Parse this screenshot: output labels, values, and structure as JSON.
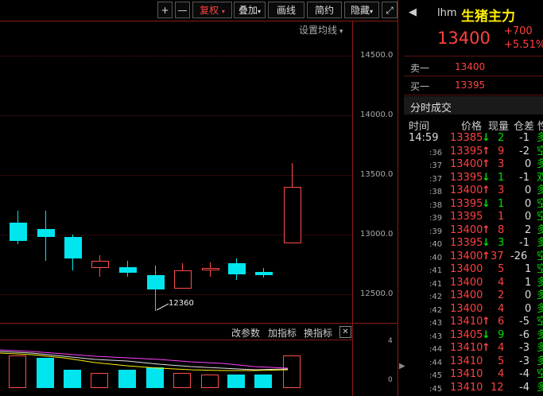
{
  "toolbar": {
    "plus": "+",
    "minus": "—",
    "fuquan": "复权",
    "diejia": "叠加",
    "huaxian": "画线",
    "jianyue": "简约",
    "yincang": "隐藏",
    "expand": "⤢"
  },
  "main_chart": {
    "ma_setting": "设置均线",
    "price_labels": [
      "14500.0",
      "14000.0",
      "13500.0",
      "13000.0",
      "12500.0"
    ],
    "low_annotation": "12360",
    "colors": {
      "up": "#ff4a4a",
      "down": "#00e5ee",
      "grid": "#8b1a1a"
    }
  },
  "chart_data": {
    "type": "candlestick",
    "ylim": [
      12300,
      14700
    ],
    "candles": [
      {
        "open": 13100,
        "close": 12950,
        "high": 13200,
        "low": 12920
      },
      {
        "open": 13050,
        "close": 12980,
        "high": 13200,
        "low": 12780
      },
      {
        "open": 12980,
        "close": 12800,
        "high": 13000,
        "low": 12700
      },
      {
        "open": 12720,
        "close": 12780,
        "high": 12830,
        "low": 12650
      },
      {
        "open": 12730,
        "close": 12680,
        "high": 12780,
        "low": 12650
      },
      {
        "open": 12660,
        "close": 12540,
        "high": 12740,
        "low": 12360
      },
      {
        "open": 12550,
        "close": 12700,
        "high": 12760,
        "low": 12550
      },
      {
        "open": 12700,
        "close": 12720,
        "high": 12770,
        "low": 12650
      },
      {
        "open": 12760,
        "close": 12670,
        "high": 12800,
        "low": 12620
      },
      {
        "open": 12690,
        "close": 12660,
        "high": 12720,
        "low": 12640
      },
      {
        "open": 12930,
        "close": 13400,
        "high": 13600,
        "low": 12930
      }
    ],
    "sub_chart": {
      "type": "bar",
      "ylim": [
        0,
        4
      ],
      "tick_labels": [
        "4",
        "0"
      ],
      "values": [
        2.8,
        2.6,
        1.6,
        1.3,
        1.6,
        1.8,
        1.3,
        1.2,
        1.2,
        1.2,
        2.8
      ],
      "up": [
        true,
        false,
        false,
        true,
        false,
        false,
        true,
        true,
        false,
        false,
        true
      ]
    }
  },
  "sub_toolbar": {
    "gaicanshu": "改参数",
    "jiazhibiao": "加指标",
    "huanzhibiao": "换指标",
    "close": "✕"
  },
  "right_panel": {
    "code": "lhm",
    "name": "生猪主力",
    "price": "13400",
    "change": "+700",
    "change_pct": "+5.51%",
    "sell1_label": "卖一",
    "sell1_price": "13400",
    "buy1_label": "买一",
    "buy1_price": "13395",
    "section_title": "分时成交",
    "headers": {
      "time": "时间",
      "price": "价格",
      "vol": "现量",
      "diff": "仓差",
      "nature": "性"
    },
    "trades": [
      {
        "time": "14:59",
        "price": "13385",
        "dir": "↓",
        "vol": "2",
        "diff": "-1",
        "nat": "多"
      },
      {
        "time": ":36",
        "price": "13395",
        "dir": "↑",
        "vol": "9",
        "diff": "-2",
        "nat": "空"
      },
      {
        "time": ":37",
        "price": "13400",
        "dir": "↑",
        "vol": "3",
        "diff": "0",
        "nat": "多"
      },
      {
        "time": ":37",
        "price": "13395",
        "dir": "↓",
        "vol": "1",
        "diff": "-1",
        "nat": "双"
      },
      {
        "time": ":38",
        "price": "13400",
        "dir": "↑",
        "vol": "3",
        "diff": "0",
        "nat": "多"
      },
      {
        "time": ":38",
        "price": "13395",
        "dir": "↓",
        "vol": "1",
        "diff": "0",
        "nat": "空"
      },
      {
        "time": ":39",
        "price": "13395",
        "dir": "",
        "vol": "1",
        "diff": "0",
        "nat": "空"
      },
      {
        "time": ":39",
        "price": "13400",
        "dir": "↑",
        "vol": "8",
        "diff": "2",
        "nat": "多"
      },
      {
        "time": ":40",
        "price": "13395",
        "dir": "↓",
        "vol": "3",
        "diff": "-1",
        "nat": "多"
      },
      {
        "time": ":40",
        "price": "13400",
        "dir": "↑",
        "vol": "37",
        "diff": "-26",
        "nat": "空"
      },
      {
        "time": ":41",
        "price": "13400",
        "dir": "",
        "vol": "5",
        "diff": "1",
        "nat": "空"
      },
      {
        "time": ":41",
        "price": "13400",
        "dir": "",
        "vol": "4",
        "diff": "1",
        "nat": "多"
      },
      {
        "time": ":42",
        "price": "13400",
        "dir": "",
        "vol": "2",
        "diff": "0",
        "nat": "多"
      },
      {
        "time": ":42",
        "price": "13400",
        "dir": "",
        "vol": "4",
        "diff": "0",
        "nat": "多"
      },
      {
        "time": ":43",
        "price": "13410",
        "dir": "↑",
        "vol": "6",
        "diff": "-5",
        "nat": "空"
      },
      {
        "time": ":43",
        "price": "13405",
        "dir": "↓",
        "vol": "9",
        "diff": "-6",
        "nat": "多"
      },
      {
        "time": ":44",
        "price": "13410",
        "dir": "↑",
        "vol": "4",
        "diff": "-3",
        "nat": "多"
      },
      {
        "time": ":44",
        "price": "13410",
        "dir": "",
        "vol": "5",
        "diff": "-3",
        "nat": "多"
      },
      {
        "time": ":45",
        "price": "13410",
        "dir": "",
        "vol": "4",
        "diff": "-4",
        "nat": "空"
      },
      {
        "time": ":45",
        "price": "13410",
        "dir": "",
        "vol": "12",
        "diff": "-4",
        "nat": "多"
      }
    ]
  }
}
